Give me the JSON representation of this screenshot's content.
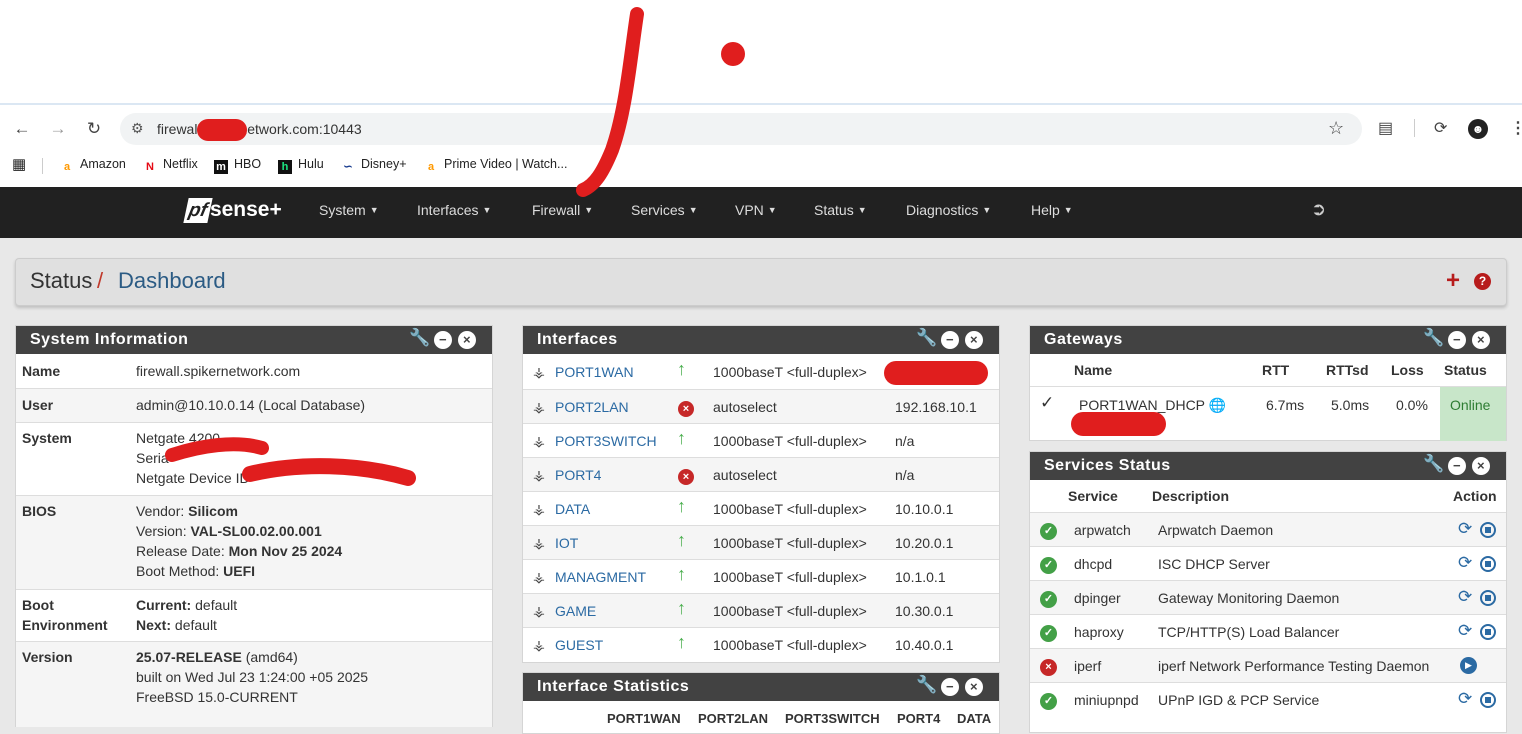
{
  "browser": {
    "url": "firewall          network.com:10443",
    "bookmarks": [
      "Amazon",
      "Netflix",
      "HBO",
      "Hulu",
      "Disney+",
      "Prime Video | Watch..."
    ]
  },
  "nav": {
    "brand_pf": "pf",
    "brand_sense": "sense+",
    "menus": [
      "System",
      "Interfaces",
      "Firewall",
      "Services",
      "VPN",
      "Status",
      "Diagnostics",
      "Help"
    ]
  },
  "breadcrumb": {
    "section": "Status",
    "separator": "/",
    "page": "Dashboard"
  },
  "system_info": {
    "title": "System Information",
    "name_label": "Name",
    "name_value": "firewall.spikernetwork.com",
    "user_label": "User",
    "user_value": "admin@10.10.0.14 (Local Database)",
    "system_label": "System",
    "system_line1": "Netgate 4200",
    "system_line2": "Seria",
    "system_line3": "Netgate Device ID",
    "bios_label": "BIOS",
    "bios_vendor_k": "Vendor: ",
    "bios_vendor_v": "Silicom",
    "bios_version_k": "Version: ",
    "bios_version_v": "VAL-SL00.02.00.001",
    "bios_release_k": "Release Date: ",
    "bios_release_v": "Mon Nov 25 2024",
    "bios_boot_k": "Boot Method: ",
    "bios_boot_v": "UEFI",
    "bootenv_label1": "Boot",
    "bootenv_label2": "Environment",
    "boot_current_k": "Current:",
    "boot_current_v": " default",
    "boot_next_k": "Next:",
    "boot_next_v": " default",
    "version_label": "Version",
    "version_bold": "25.07-RELEASE",
    "version_arch": " (amd64)",
    "version_built": "built on Wed Jul 23 1:24:00 +05 2025",
    "version_os": "FreeBSD 15.0-CURRENT"
  },
  "interfaces": {
    "title": "Interfaces",
    "rows": [
      {
        "name": "PORT1WAN",
        "status": "up",
        "media": "1000baseT <full-duplex>",
        "ip": ""
      },
      {
        "name": "PORT2LAN",
        "status": "down",
        "media": "autoselect",
        "ip": "192.168.10.1"
      },
      {
        "name": "PORT3SWITCH",
        "status": "up",
        "media": "1000baseT <full-duplex>",
        "ip": "n/a"
      },
      {
        "name": "PORT4",
        "status": "down",
        "media": "autoselect",
        "ip": "n/a"
      },
      {
        "name": "DATA",
        "status": "up",
        "media": "1000baseT <full-duplex>",
        "ip": "10.10.0.1"
      },
      {
        "name": "IOT",
        "status": "up",
        "media": "1000baseT <full-duplex>",
        "ip": "10.20.0.1"
      },
      {
        "name": "MANAGMENT",
        "status": "up",
        "media": "1000baseT <full-duplex>",
        "ip": "10.1.0.1"
      },
      {
        "name": "GAME",
        "status": "up",
        "media": "1000baseT <full-duplex>",
        "ip": "10.30.0.1"
      },
      {
        "name": "GUEST",
        "status": "up",
        "media": "1000baseT <full-duplex>",
        "ip": "10.40.0.1"
      }
    ]
  },
  "interface_stats": {
    "title": "Interface Statistics",
    "columns": [
      "PORT1WAN",
      "PORT2LAN",
      "PORT3SWITCH",
      "PORT4",
      "DATA"
    ]
  },
  "gateways": {
    "title": "Gateways",
    "headers": {
      "name": "Name",
      "rtt": "RTT",
      "rttsd": "RTTsd",
      "loss": "Loss",
      "status": "Status"
    },
    "rows": [
      {
        "name": "PORT1WAN_DHCP",
        "rtt": "6.7ms",
        "rttsd": "5.0ms",
        "loss": "0.0%",
        "status": "Online"
      }
    ]
  },
  "services": {
    "title": "Services Status",
    "headers": {
      "service": "Service",
      "description": "Description",
      "action": "Action"
    },
    "rows": [
      {
        "name": "arpwatch",
        "desc": "Arpwatch Daemon",
        "running": true
      },
      {
        "name": "dhcpd",
        "desc": "ISC DHCP Server",
        "running": true
      },
      {
        "name": "dpinger",
        "desc": "Gateway Monitoring Daemon",
        "running": true
      },
      {
        "name": "haproxy",
        "desc": "TCP/HTTP(S) Load Balancer",
        "running": true
      },
      {
        "name": "iperf",
        "desc": "iperf Network Performance Testing Daemon",
        "running": false
      },
      {
        "name": "miniupnpd",
        "desc": "UPnP IGD & PCP Service",
        "running": true
      }
    ]
  },
  "colors": {
    "navbar": "#212121",
    "panel_header": "#424242",
    "link": "#2b6aa3",
    "online": "#c8e6c9",
    "annotation": "#e01e1e"
  }
}
